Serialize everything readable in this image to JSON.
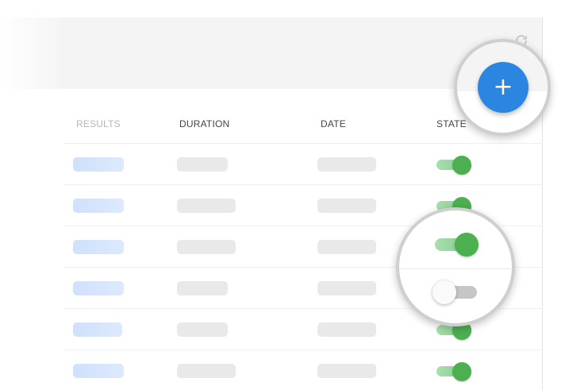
{
  "table": {
    "columns": {
      "results": "RESULTS",
      "duration": "DURATION",
      "date": "DATE",
      "state": "STATE"
    },
    "rows": [
      {
        "state": "on"
      },
      {
        "state": "on"
      },
      {
        "state": "on"
      },
      {
        "state": "on"
      },
      {
        "state": "on"
      },
      {
        "state": "on"
      }
    ]
  },
  "zoom_callouts": {
    "add_button": {
      "icon": "plus-icon",
      "glyph": "+",
      "color": "#2b86e0"
    },
    "toggles": [
      {
        "state": "on",
        "color": "#4caf50"
      },
      {
        "state": "off",
        "color": "#c6c6c6"
      }
    ]
  },
  "icons": {
    "refresh": "refresh-icon"
  },
  "colors": {
    "accent_blue": "#2b86e0",
    "toggle_on": "#4caf50",
    "toggle_off": "#c6c6c6",
    "placeholder_blue": "#cfe1fb",
    "placeholder_gray": "#e9e9e9"
  }
}
